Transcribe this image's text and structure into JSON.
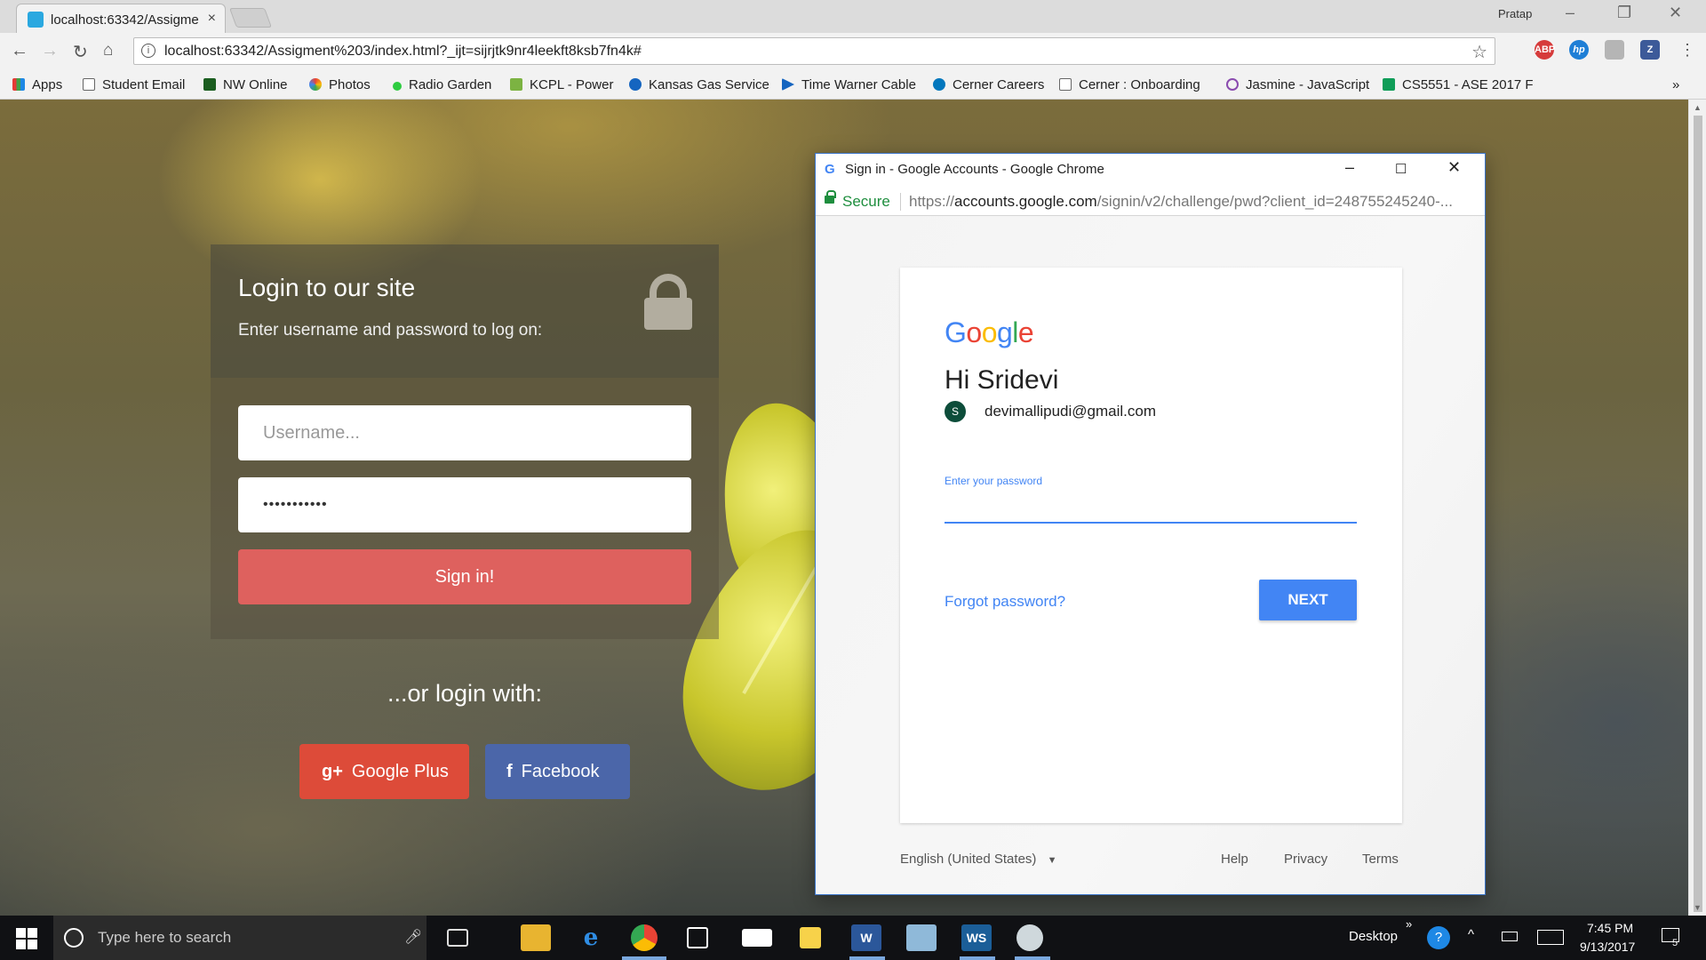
{
  "browser": {
    "tab_title": "localhost:63342/Assigme",
    "tab_close": "×",
    "profile_name": "Pratap",
    "url": "localhost:63342/Assigment%203/index.html?_ijt=sijrjtk9nr4leekft8ksb7fn4k#",
    "bookmarks": [
      "Apps",
      "Student Email",
      "NW Online",
      "Photos",
      "Radio Garden",
      "KCPL - Power",
      "Kansas Gas Service",
      "Time Warner Cable",
      "Cerner Careers",
      "Cerner : Onboarding",
      "Jasmine - JavaScript",
      "CS5551 - ASE 2017 F"
    ],
    "bookmarks_overflow": "»",
    "extensions": [
      "ABP",
      "hp",
      "Z"
    ]
  },
  "login": {
    "title": "Login to our site",
    "subtitle": "Enter username and password to log on:",
    "username_placeholder": "Username...",
    "password_value": "•••••••••••",
    "signin_label": "Sign in!",
    "or_text": "...or login with:",
    "google_icon": "g+",
    "google_label": "Google Plus",
    "facebook_icon": "f",
    "facebook_label": "Facebook"
  },
  "popup": {
    "window_title": "Sign in - Google Accounts - Google Chrome",
    "secure_label": "Secure",
    "url_prefix": "https://",
    "url_host": "accounts.google.com",
    "url_path": "/signin/v2/challenge/pwd?client_id=248755245240-...",
    "logo_letters": [
      "G",
      "o",
      "o",
      "g",
      "l",
      "e"
    ],
    "greeting": "Hi Sridevi",
    "avatar_letter": "S",
    "email": "devimallipudi@gmail.com",
    "password_label": "Enter your password",
    "forgot_label": "Forgot password?",
    "next_label": "NEXT",
    "language": "English (United States)",
    "footer_links": [
      "Help",
      "Privacy",
      "Terms"
    ]
  },
  "colors": {
    "signin_button": "#de615e",
    "google_plus": "#dd4b39",
    "facebook": "#4b66a9",
    "google_blue": "#4285f4",
    "logo": [
      "#4285f4",
      "#ea4335",
      "#fbbc05",
      "#4285f4",
      "#34a853",
      "#ea4335"
    ]
  },
  "taskbar": {
    "search_placeholder": "Type here to search",
    "desktop_label": "Desktop",
    "desktop_chevron": "»",
    "time": "7:45 PM",
    "date": "9/13/2017",
    "notification_count": "5"
  }
}
